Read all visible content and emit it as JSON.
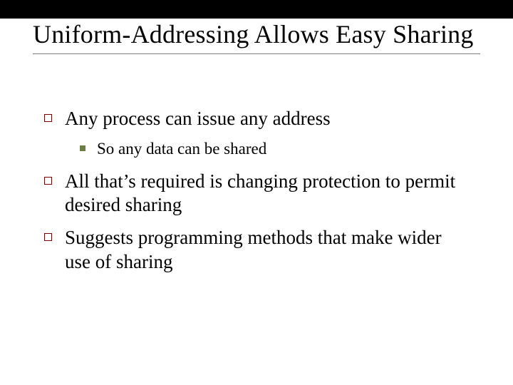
{
  "title": "Uniform-Addressing Allows Easy Sharing",
  "bullets": [
    {
      "text": "Any process can issue any address",
      "sub": [
        {
          "text": "So any data can be shared"
        }
      ]
    },
    {
      "text": "All that’s required is changing protection to permit desired sharing",
      "sub": []
    },
    {
      "text": "Suggests programming methods that make wider use of sharing",
      "sub": []
    }
  ]
}
